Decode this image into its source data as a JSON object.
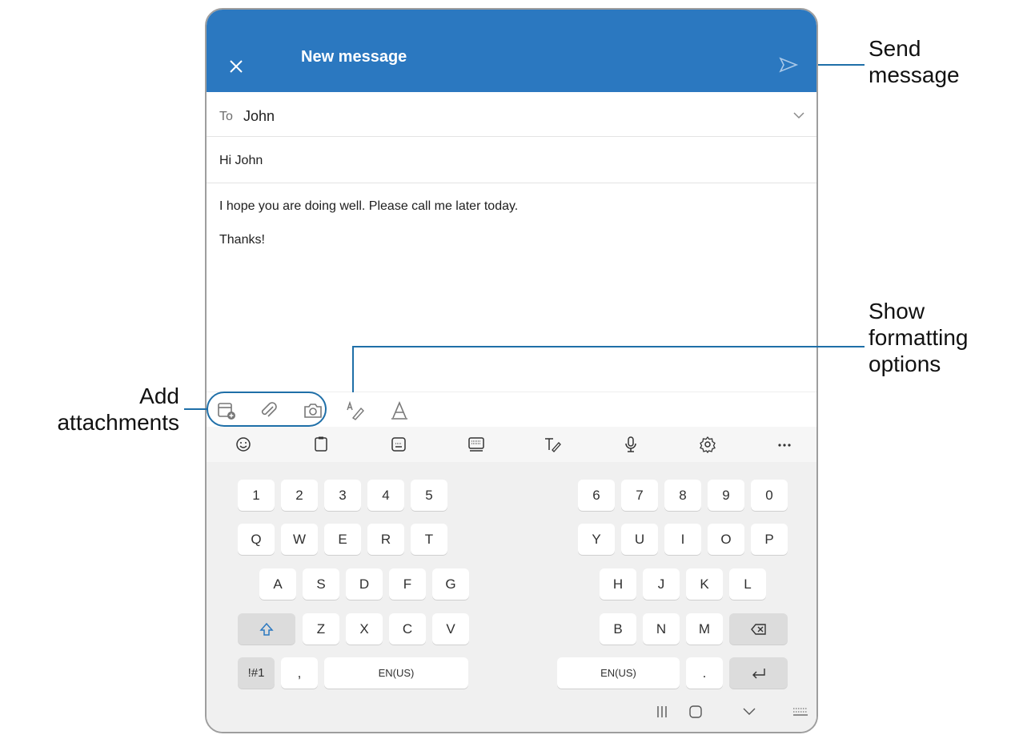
{
  "header": {
    "title": "New message"
  },
  "compose": {
    "to_label": "To",
    "to_value": "John",
    "subject": "Hi John",
    "body_line1": "I hope you are doing well. Please call me later today.",
    "body_line2": "Thanks!"
  },
  "keyboard": {
    "row1_left": [
      "1",
      "2",
      "3",
      "4",
      "5"
    ],
    "row1_right": [
      "6",
      "7",
      "8",
      "9",
      "0"
    ],
    "row2_left": [
      "Q",
      "W",
      "E",
      "R",
      "T"
    ],
    "row2_right": [
      "Y",
      "U",
      "I",
      "O",
      "P"
    ],
    "row3_left": [
      "A",
      "S",
      "D",
      "F",
      "G"
    ],
    "row3_right": [
      "H",
      "J",
      "K",
      "L"
    ],
    "row4_left": [
      "Z",
      "X",
      "C",
      "V"
    ],
    "row4_right": [
      "B",
      "N",
      "M"
    ],
    "symbols_label": "!#1",
    "comma": ",",
    "space_left_label": "EN(US)",
    "space_right_label": "EN(US)",
    "period": "."
  },
  "callouts": {
    "send": [
      "Send",
      "message"
    ],
    "formatting": [
      "Show",
      "formatting",
      "options"
    ],
    "attachments": [
      "Add",
      "attachments"
    ]
  },
  "colors": {
    "accent": "#2b78c0",
    "callout_line": "#1f6fa8"
  },
  "icons": [
    "close-icon",
    "send-icon",
    "chevron-down-icon",
    "attach-file-icon",
    "paperclip-icon",
    "camera-icon",
    "handwriting-icon",
    "text-format-icon",
    "emoji-icon",
    "clipboard-icon",
    "keyboard-mode-icon",
    "keyboard-layout-icon",
    "pen-text-icon",
    "microphone-icon",
    "settings-icon",
    "more-icon",
    "shift-icon",
    "backspace-icon",
    "enter-icon",
    "recents-icon",
    "home-icon",
    "back-icon",
    "keyboard-toggle-icon"
  ]
}
